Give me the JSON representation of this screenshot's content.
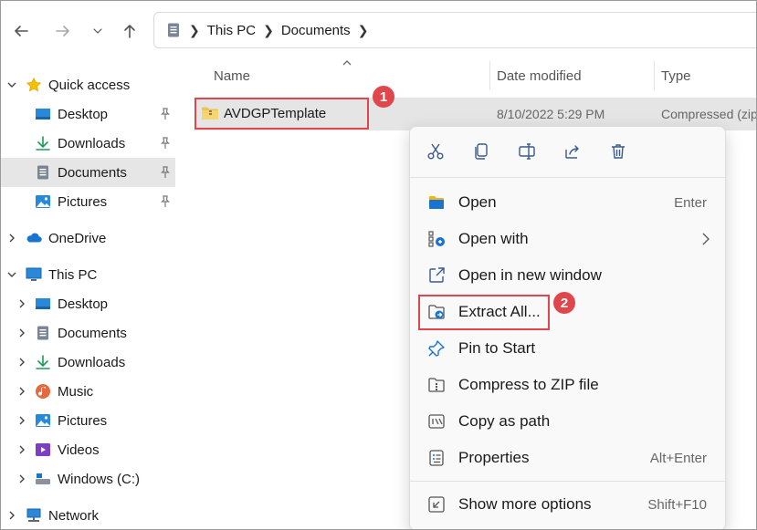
{
  "nav": {
    "back_icon": "arrow-left-icon",
    "forward_icon": "arrow-right-icon",
    "recent_icon": "chevron-down-icon",
    "up_icon": "arrow-up-icon"
  },
  "address": {
    "crumbs": [
      "This PC",
      "Documents"
    ]
  },
  "sidebar": {
    "quick_access": "Quick access",
    "qa_items": [
      "Desktop",
      "Downloads",
      "Documents",
      "Pictures"
    ],
    "onedrive": "OneDrive",
    "this_pc": "This PC",
    "pc_items": [
      "Desktop",
      "Documents",
      "Downloads",
      "Music",
      "Pictures",
      "Videos",
      "Windows (C:)"
    ],
    "network": "Network"
  },
  "columns": {
    "name": "Name",
    "date_modified": "Date modified",
    "type": "Type"
  },
  "file": {
    "name": "AVDGPTemplate",
    "date": "8/10/2022 5:29 PM",
    "type": "Compressed (zip"
  },
  "callouts": {
    "one": "1",
    "two": "2"
  },
  "context_menu": {
    "quick_actions": [
      "cut-icon",
      "copy-icon",
      "rename-icon",
      "share-icon",
      "delete-icon"
    ],
    "items": [
      {
        "label": "Open",
        "accel": "Enter"
      },
      {
        "label": "Open with",
        "accel": ""
      },
      {
        "label": "Open in new window",
        "accel": ""
      },
      {
        "label": "Extract All...",
        "accel": ""
      },
      {
        "label": "Pin to Start",
        "accel": ""
      },
      {
        "label": "Compress to ZIP file",
        "accel": ""
      },
      {
        "label": "Copy as path",
        "accel": ""
      },
      {
        "label": "Properties",
        "accel": "Alt+Enter"
      },
      {
        "label": "Show more options",
        "accel": "Shift+F10"
      }
    ]
  },
  "colors": {
    "highlight": "#e0474c",
    "selected_bg": "#e6e6e6",
    "accent": "#0a64c8"
  }
}
